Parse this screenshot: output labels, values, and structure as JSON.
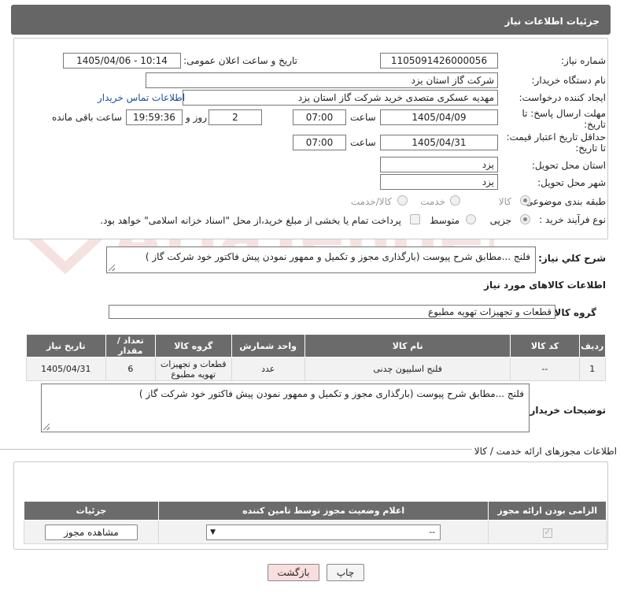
{
  "header": {
    "title": "جزئیات اطلاعات نیاز"
  },
  "form": {
    "need_number_label": "شماره نیاز:",
    "need_number": "1105091426000056",
    "announce_label": "تاریخ و ساعت اعلان عمومی:",
    "announce_value": "1405/04/06 - 10:14",
    "buyer_org_label": "نام دستگاه خریدار:",
    "buyer_org": "شرکت گاز استان یزد",
    "creator_label": "ایجاد کننده درخواست:",
    "creator": "مهدیه عسکری متصدی خرید شرکت گاز استان یزد",
    "contact_link": "اطلاعات تماس خریدار",
    "reply_deadline_label_1": "مهلت ارسال پاسخ: تا",
    "reply_deadline_label_2": "تاریخ:",
    "reply_date": "1405/04/09",
    "time_label": "ساعت",
    "reply_time": "07:00",
    "days_value": "2",
    "days_label": "روز و",
    "remaining_time": "19:59:36",
    "remaining_label": "ساعت باقی مانده",
    "price_deadline_label_1": "حداقل تاریخ اعتبار قیمت:",
    "price_deadline_label_2": "تا تاریخ:",
    "price_date": "1405/04/31",
    "price_time": "07:00",
    "province_label": "استان محل تحویل:",
    "province": "یزد",
    "city_label": "شهر محل تحویل:",
    "city": "یزد",
    "category_label": "طبقه بندی موضوعی:",
    "category_options": [
      "کالا",
      "خدمت",
      "کالا/خدمت"
    ],
    "process_label": "نوع فرآیند خرید :",
    "process_options": [
      "جزیی",
      "متوسط"
    ],
    "payment_note": "پرداخت تمام یا بخشی از مبلغ خرید،از محل \"اسناد خزانه اسلامی\" خواهد بود."
  },
  "summary": {
    "label": "شرح کلي نياز:",
    "text": "فلنج ...مطابق شرح پیوست (بارگذاری مجوز و تکمیل و ممهور نمودن پیش فاکتور خود شرکت گاز )"
  },
  "goods": {
    "section_title": "اطلاعات کالاهای مورد نیاز",
    "group_label": "گروه کالا:",
    "group_value": "قطعات و تجهیزات تهویه مطبوع",
    "columns": [
      "ردیف",
      "کد کالا",
      "نام کالا",
      "واحد شمارش",
      "گروه کالا",
      "تعداد / مقدار",
      "تاریخ نیاز"
    ],
    "rows": [
      {
        "row": "1",
        "code": "--",
        "name": "فلنج اسلیپون چدنی",
        "unit": "عدد",
        "group": "قطعات و تجهیزات تهویه مطبوع",
        "qty": "6",
        "date": "1405/04/31"
      }
    ],
    "buyer_notes_label": "توضیحات خریدار:",
    "buyer_notes": "فلنج ...مطابق شرح پیوست (بارگذاری مجوز و تکمیل و ممهور نمودن پیش فاکتور خود شرکت گاز )"
  },
  "permits": {
    "section_title": "اطلاعات مجوزهای ارائه خدمت / کالا",
    "columns": [
      "الزامی بودن ارائه مجوز",
      "اعلام وضعیت مجوز توسط تامین کننده",
      "جزئیات"
    ],
    "select_value": "--",
    "view_button": "مشاهده مجوز"
  },
  "buttons": {
    "print": "چاپ",
    "back": "بازگشت"
  },
  "watermark": "AriaTender.neT",
  "colors": {
    "header_bg": "#666666",
    "link": "#1a4fa0",
    "back_button": "#f9dede",
    "watermark": "#c0392b"
  }
}
